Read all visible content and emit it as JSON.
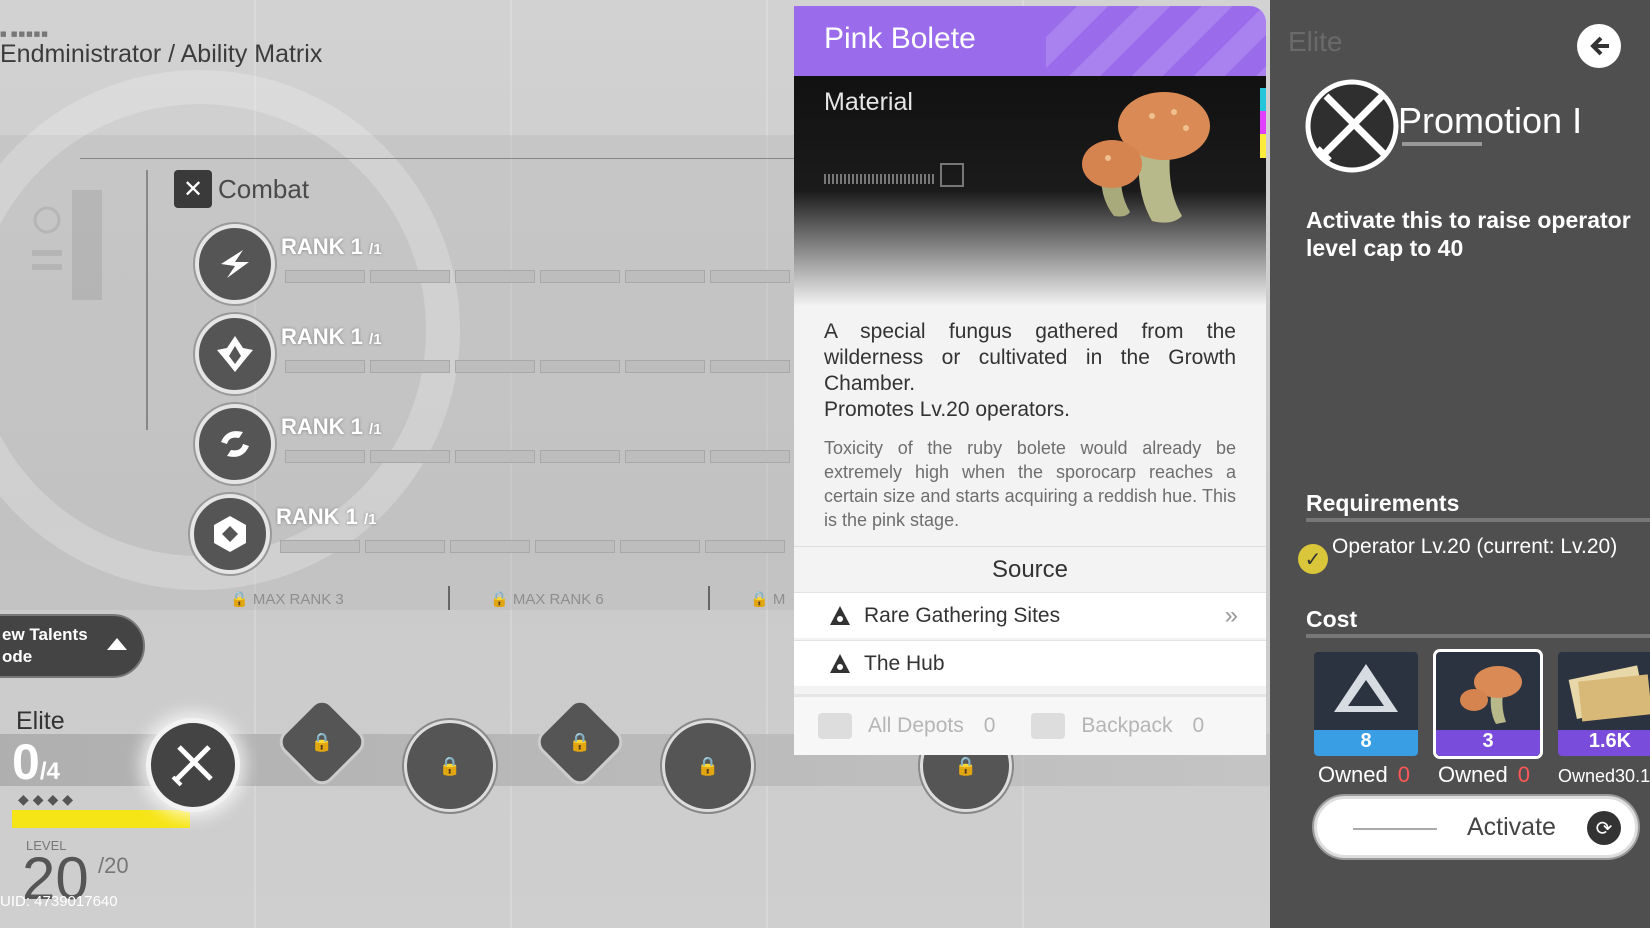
{
  "breadcrumb": {
    "small": "■ ■■■■■",
    "text": "Endministrator / Ability Matrix"
  },
  "combat": {
    "label": "Combat",
    "icon": "combat-icon"
  },
  "talents": [
    {
      "rank": "RANK 1",
      "max": "/1",
      "icon": "lightning-icon"
    },
    {
      "rank": "RANK 1",
      "max": "/1",
      "icon": "shield-burst-icon"
    },
    {
      "rank": "RANK 1",
      "max": "/1",
      "icon": "swirl-icon"
    },
    {
      "rank": "RANK 1",
      "max": "/1",
      "icon": "hex-target-icon"
    }
  ],
  "max_ranks": [
    "MAX RANK 3",
    "MAX RANK 6",
    "M"
  ],
  "view_talents": {
    "line1": "ew Talents",
    "line2": "ode"
  },
  "elite": {
    "label": "Elite",
    "count": "0",
    "count_max": "/4",
    "dots": "◆◆◆◆",
    "level_label": "LEVEL",
    "level": "20",
    "level_max": "/20",
    "uid": "UID: 4739017640"
  },
  "item": {
    "title": "Pink Bolete",
    "type": "Material",
    "description_1": "A special fungus gathered from the wilderness or cultivated in the Growth Chamber.",
    "description_2": "Promotes Lv.20 operators.",
    "flavor": "Toxicity of the ruby bolete would already be extremely high when the sporocarp reaches a certain size and starts acquiring a reddish hue. This is the pink stage.",
    "source_label": "Source",
    "sources": [
      {
        "label": "Rare Gathering Sites",
        "icon": "location-triangle-icon",
        "has_arrow": true
      },
      {
        "label": "The Hub",
        "icon": "location-triangle-icon",
        "has_arrow": false
      }
    ],
    "depots_label": "All Depots",
    "depots_value": "0",
    "backpack_label": "Backpack",
    "backpack_value": "0",
    "header_color": "#9a6cec"
  },
  "panel": {
    "elite_label": "Elite",
    "title": "Promotion I",
    "description": "Activate this to raise operator level cap to 40",
    "requirements_label": "Requirements",
    "requirement": "Operator Lv.20 (current: Lv.20)",
    "cost_label": "Cost",
    "costs": [
      {
        "qty": "8",
        "owned_label": "Owned",
        "owned": "0",
        "icon": "crystal-icon",
        "band_color": "#3a9ee4"
      },
      {
        "qty": "3",
        "owned_label": "Owned",
        "owned": "0",
        "icon": "pink-bolete-icon",
        "band_color": "#7a4cdb"
      },
      {
        "qty": "1.6K",
        "owned_label": "Owned",
        "owned": "30.1",
        "icon": "credits-icon",
        "band_color": "#7a4cdb"
      }
    ],
    "activate_label": "Activate",
    "owned_zero_color": "#ff5757"
  }
}
